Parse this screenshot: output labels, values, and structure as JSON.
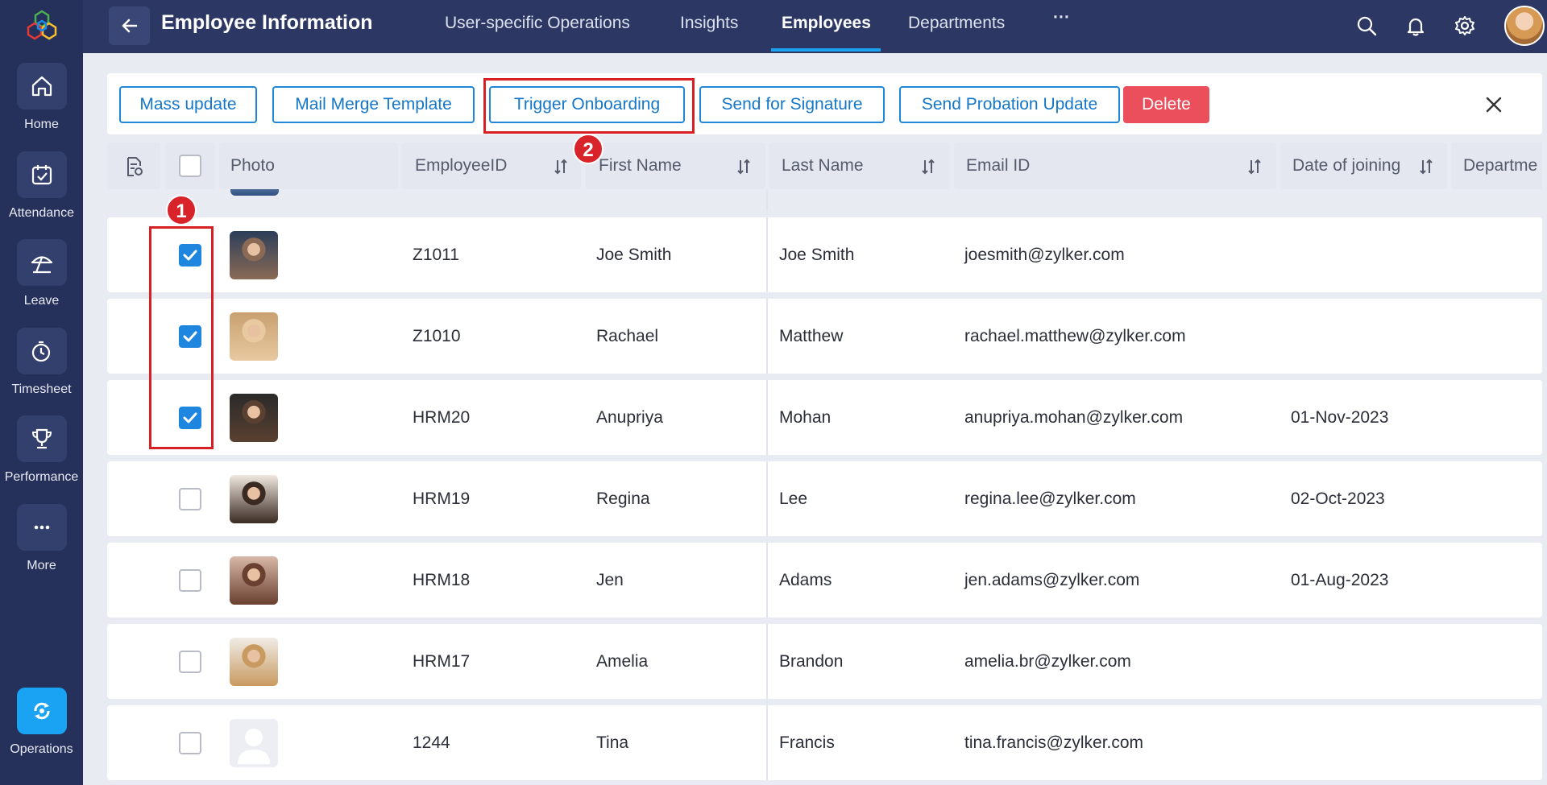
{
  "sidebar": {
    "items": [
      {
        "label": "Home",
        "icon": "home-icon"
      },
      {
        "label": "Attendance",
        "icon": "calendar-check-icon"
      },
      {
        "label": "Leave",
        "icon": "umbrella-icon"
      },
      {
        "label": "Timesheet",
        "icon": "timer-icon"
      },
      {
        "label": "Performance",
        "icon": "trophy-icon"
      },
      {
        "label": "More",
        "icon": "more-dots-icon"
      },
      {
        "label": "Operations",
        "icon": "operations-icon"
      }
    ]
  },
  "topbar": {
    "title": "Employee Information",
    "tabs": [
      "User-specific Operations",
      "Insights",
      "Employees",
      "Departments"
    ],
    "active_tab": "Employees",
    "more": "···"
  },
  "actions": {
    "mass_update": "Mass update",
    "mail_merge": "Mail Merge Template",
    "trigger_onboarding": "Trigger Onboarding",
    "send_signature": "Send for Signature",
    "send_probation": "Send Probation Update",
    "delete": "Delete"
  },
  "annotations": {
    "step1": "1",
    "step2": "2"
  },
  "table": {
    "columns": [
      "Photo",
      "EmployeeID",
      "First Name",
      "Last Name",
      "Email ID",
      "Date of joining",
      "Departme"
    ],
    "rows": [
      {
        "id": "Z1011",
        "first": "Joe Smith",
        "last": "Joe Smith",
        "email": "joesmith@zylker.com",
        "doj": "",
        "checked": true
      },
      {
        "id": "Z1010",
        "first": "Rachael",
        "last": "Matthew",
        "email": "rachael.matthew@zylker.com",
        "doj": "",
        "checked": true
      },
      {
        "id": "HRM20",
        "first": "Anupriya",
        "last": "Mohan",
        "email": "anupriya.mohan@zylker.com",
        "doj": "01-Nov-2023",
        "checked": true
      },
      {
        "id": "HRM19",
        "first": "Regina",
        "last": "Lee",
        "email": "regina.lee@zylker.com",
        "doj": "02-Oct-2023",
        "checked": false
      },
      {
        "id": "HRM18",
        "first": "Jen",
        "last": "Adams",
        "email": "jen.adams@zylker.com",
        "doj": "01-Aug-2023",
        "checked": false
      },
      {
        "id": "HRM17",
        "first": "Amelia",
        "last": "Brandon",
        "email": "amelia.br@zylker.com",
        "doj": "",
        "checked": false
      },
      {
        "id": "1244",
        "first": "Tina",
        "last": "Francis",
        "email": "tina.francis@zylker.com",
        "doj": "",
        "checked": false
      }
    ]
  },
  "colors": {
    "accent": "#1aa3f2",
    "sidebar": "#25305b",
    "topbar": "#2c3863",
    "delete": "#ea4f5b",
    "highlight": "#d81f24"
  }
}
